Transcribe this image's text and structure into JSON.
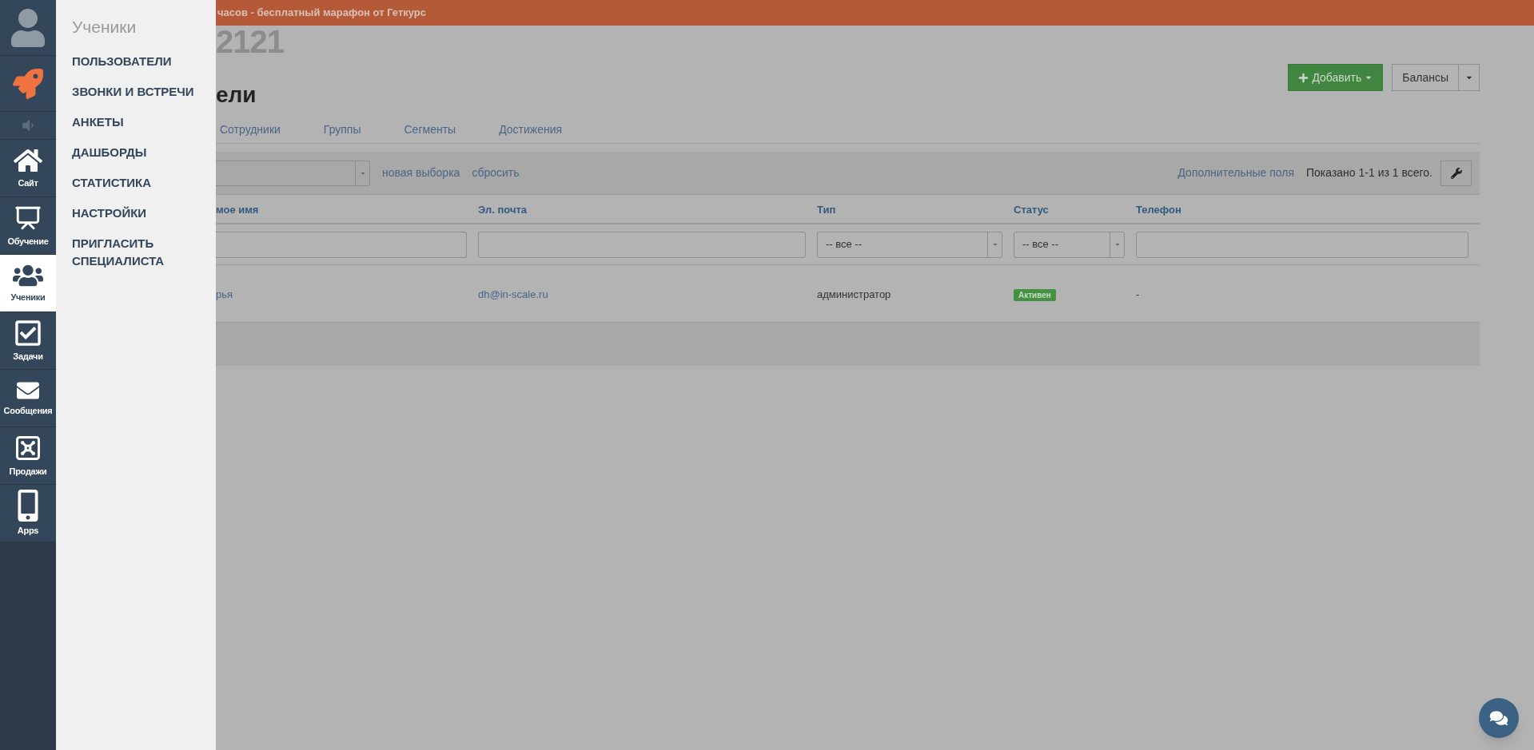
{
  "banner": {
    "text": "часов - бесплатный марафон от Геткурс"
  },
  "rail": [
    {
      "kind": "avatar",
      "selected": false
    },
    {
      "kind": "rocket",
      "selected": false
    },
    {
      "kind": "speaker",
      "selected": false
    },
    {
      "kind": "home",
      "label": "Сайт",
      "selected": false
    },
    {
      "kind": "chart",
      "label": "Обучение",
      "selected": false
    },
    {
      "kind": "users",
      "label": "Ученики",
      "selected": true
    },
    {
      "kind": "check",
      "label": "Задачи",
      "selected": false
    },
    {
      "kind": "mail",
      "label": "Сообщения",
      "selected": false
    },
    {
      "kind": "safe",
      "label": "Продажи",
      "selected": false
    },
    {
      "kind": "phone",
      "label": "Apps",
      "selected": false
    }
  ],
  "menu": {
    "title": "Ученики",
    "items": [
      "ПОЛЬЗОВАТЕЛИ",
      "ЗВОНКИ И ВСТРЕЧИ",
      "АНКЕТЫ",
      "ДАШБОРДЫ",
      "СТАТИСТИКА",
      "НАСТРОЙКИ",
      "ПРИГЛАСИТЬ СПЕЦИАЛИСТА"
    ]
  },
  "page": {
    "account": "2121",
    "heading": "ели",
    "add_button": "Добавить",
    "balances_button": "Балансы",
    "tabs": [
      "Сотрудники",
      "Группы",
      "Сегменты",
      "Достижения"
    ]
  },
  "filter_bar": {
    "links": [
      "новая выборка",
      "сбросить"
    ],
    "extra_fields": "Дополнительные поля",
    "shown": "Показано 1-1 из 1 всего."
  },
  "table": {
    "columns": [
      {
        "title": "мое имя",
        "filter": {
          "kind": "text"
        }
      },
      {
        "title": "Эл. почта",
        "filter": {
          "kind": "text"
        }
      },
      {
        "title": "Тип",
        "filter": {
          "kind": "select",
          "value": "-- все --"
        }
      },
      {
        "title": "Статус",
        "filter": {
          "kind": "select",
          "value": "-- все --"
        }
      },
      {
        "title": "Телефон",
        "filter": {
          "kind": "text"
        }
      }
    ],
    "rows": [
      {
        "name": "рья",
        "email": "dh@in-scale.ru",
        "type": "администратор",
        "status": "Активен",
        "phone": "-"
      }
    ]
  }
}
